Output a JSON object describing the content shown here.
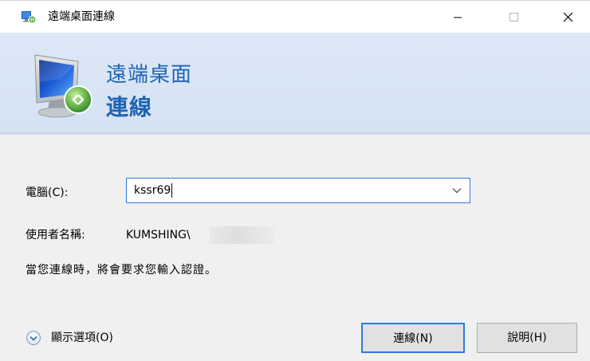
{
  "window": {
    "title": "遠端桌面連線",
    "icon": "remote-desktop-icon",
    "controls": {
      "minimize": "minimize-icon",
      "maximize": "maximize-icon",
      "close": "close-icon"
    }
  },
  "banner": {
    "line1": "遠端桌面",
    "line2": "連線",
    "icon": "remote-desktop-monitor-icon",
    "accent": "#1f63b5"
  },
  "form": {
    "computer_label": "電腦(C):",
    "computer_value": "kssr69",
    "user_label": "使用者名稱:",
    "user_value": "KUMSHING\\",
    "note": "當您連線時，將會要求您輸入認證。"
  },
  "footer": {
    "options_label": "顯示選項(O)",
    "connect_label": "連線(N)",
    "help_label": "說明(H)"
  }
}
